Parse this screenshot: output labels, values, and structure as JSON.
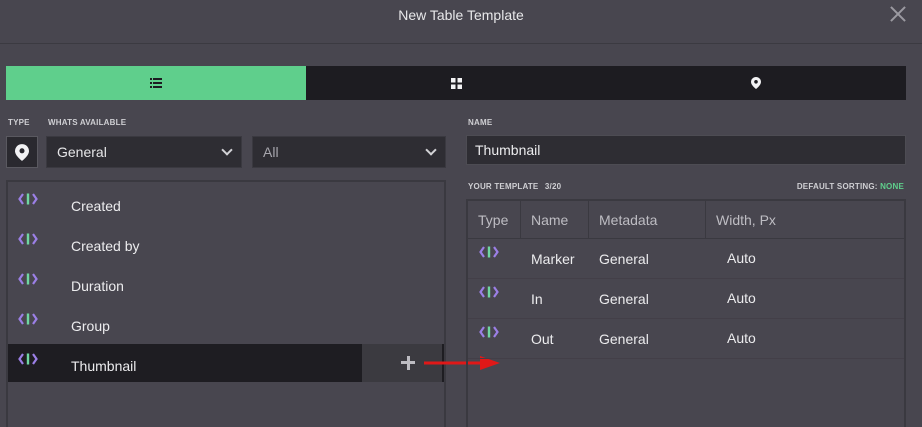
{
  "window": {
    "title": "New Table Template"
  },
  "tabs": [
    {
      "icon": "list-icon",
      "active": true
    },
    {
      "icon": "grid-icon",
      "active": false
    },
    {
      "icon": "map-pin-icon",
      "active": false
    }
  ],
  "left": {
    "type_label": "TYPE",
    "available_label": "WHATS AVAILABLE",
    "type_icon": "map-pin-icon",
    "category_select": "General",
    "filter_select": "All",
    "items": [
      {
        "label": "Created",
        "icon": "metadata-code-icon"
      },
      {
        "label": "Created by",
        "icon": "metadata-code-icon"
      },
      {
        "label": "Duration",
        "icon": "metadata-code-icon"
      },
      {
        "label": "Group",
        "icon": "metadata-code-icon"
      },
      {
        "label": "Thumbnail",
        "icon": "metadata-code-icon",
        "selected": true
      }
    ],
    "add_icon": "plus-icon"
  },
  "right": {
    "name_label": "NAME",
    "name_value": "Thumbnail",
    "template_label": "YOUR TEMPLATE",
    "template_count": "3/20",
    "sorting_label": "DEFAULT SORTING:",
    "sorting_value": "NONE",
    "columns": [
      "Type",
      "Name",
      "Metadata",
      "Width, Px"
    ],
    "rows": [
      {
        "name": "Marker",
        "metadata": "General",
        "width": "Auto"
      },
      {
        "name": "In",
        "metadata": "General",
        "width": "Auto"
      },
      {
        "name": "Out",
        "metadata": "General",
        "width": "Auto"
      }
    ]
  },
  "colors": {
    "accent": "#5fcf8c",
    "arrow": "#e01818",
    "icon_purple": "#9b7fe6",
    "icon_green": "#6fd7a2"
  }
}
